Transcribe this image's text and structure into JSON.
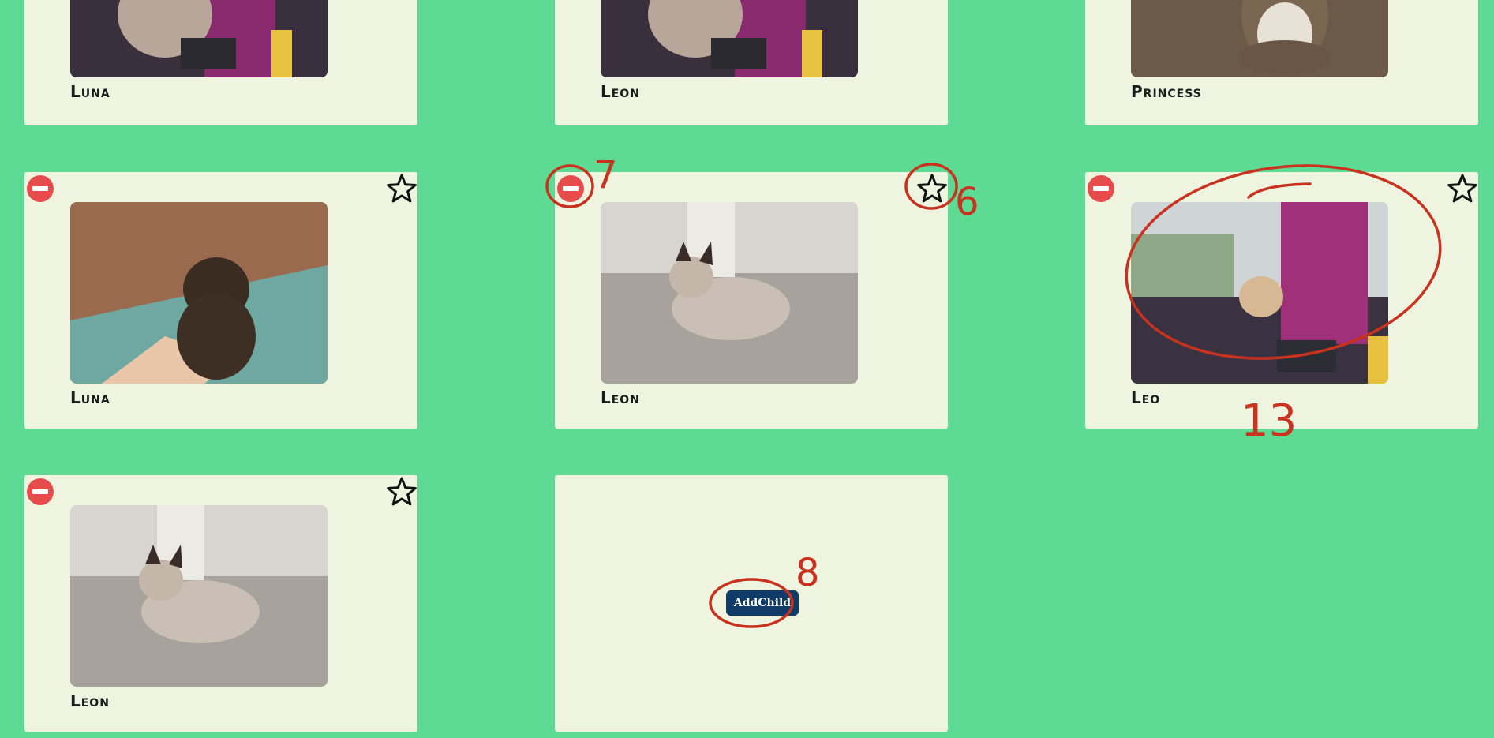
{
  "colors": {
    "background": "#5ddb94",
    "card": "#eef4df",
    "remove": "#e74c4c",
    "add_button": "#0f3b66",
    "annotation": "#c8321e"
  },
  "cards": [
    {
      "name": "Luna",
      "photo": "kitten-train-seat",
      "partial": true
    },
    {
      "name": "Leon",
      "photo": "kitten-train-seat",
      "partial": true
    },
    {
      "name": "Princess",
      "photo": "tabby-cat-wood-floor",
      "partial": true
    },
    {
      "name": "Luna",
      "photo": "fluffy-kitten-rug"
    },
    {
      "name": "Leon",
      "photo": "siamese-kitten"
    },
    {
      "name": "Leo",
      "photo": "kitten-train-window"
    },
    {
      "name": "Leon",
      "photo": "siamese-kitten"
    }
  ],
  "add_card": {
    "button_label": "AddChild"
  },
  "icons": {
    "remove": "minus-circle-icon",
    "favorite": "star-outline-icon"
  },
  "annotations": {
    "label_remove": "7",
    "label_star": "6",
    "label_add": "8",
    "label_photo": "13"
  }
}
